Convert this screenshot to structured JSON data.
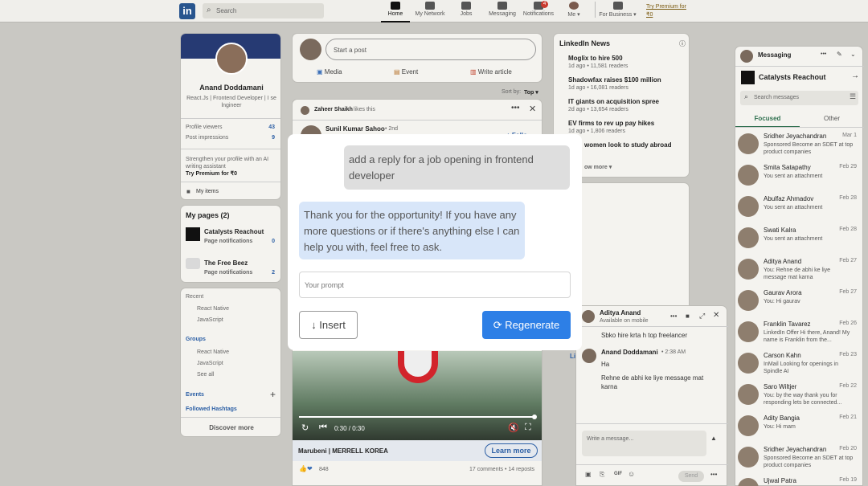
{
  "nav": {
    "logo": "in",
    "search_placeholder": "Search",
    "items": [
      "Home",
      "My Network",
      "Jobs",
      "Messaging",
      "Notifications",
      "Me ▾",
      "For Business ▾"
    ],
    "notif_count": "4",
    "premium": "Try Premium for ₹0"
  },
  "profile": {
    "name": "Anand Doddamani",
    "headline": "React.Js | Frontend Developer | I se lngineer",
    "viewers_label": "Profile viewers",
    "viewers": "43",
    "impressions_label": "Post impressions",
    "impressions": "9",
    "premium_text": "Strengthen your profile with an AI writing assistant",
    "premium_link": "Try Premium for ₹0",
    "my_items": "My items"
  },
  "pages": {
    "title": "My pages (2)",
    "items": [
      {
        "name": "Catalysts Reachout",
        "sub": "Page notifications",
        "count": "0"
      },
      {
        "name": "The Free Beez",
        "sub": "Page notifications",
        "count": "2"
      }
    ]
  },
  "recent": {
    "title": "Recent",
    "items": [
      "React Native",
      "JavaScript"
    ],
    "groups_title": "Groups",
    "groups": [
      "React Native",
      "JavaScript"
    ],
    "see_all": "See all",
    "events": "Events",
    "hashtags": "Followed Hashtags",
    "discover": "Discover more"
  },
  "post": {
    "start": "Start a post",
    "media": "Media",
    "event": "Event",
    "article": "Write article",
    "sort": "Sort by:",
    "sort_value": "Top ▾",
    "liker": "Zaheer Shaikh",
    "likes_this": "likes this",
    "author": "Sunil Kumar Sahoo",
    "degree": "• 2nd",
    "video_time": "0:30 / 0:30",
    "company": "Marubeni | MERRELL KOREA",
    "learn_more": "Learn more",
    "reactions": "848",
    "comments": "17 comments • 14 reposts",
    "partial_follow": "+ Follo"
  },
  "news": {
    "title": "LinkedIn News",
    "items": [
      {
        "h": "Moglix to hire 500",
        "s": "1d ago • 11,581 readers"
      },
      {
        "h": "Shadowfax raises $100 million",
        "s": "1d ago • 16,081 readers"
      },
      {
        "h": "IT giants on acquisition spree",
        "s": "2d ago • 13,654 readers"
      },
      {
        "h": "EV firms to rev up pay hikes",
        "s": "1d ago • 1,806 readers"
      }
    ],
    "partial": "women look to study abroad",
    "more": "ow more ▾"
  },
  "modal": {
    "user_msg": "add a reply for a job opening in frontend developer",
    "ai_msg": "Thank you for the opportunity! If you have any more questions or if there's anything else I can help you with, feel free to ask.",
    "prompt_placeholder": "Your prompt",
    "insert": "↓ Insert",
    "regenerate": "Regenerate"
  },
  "chat": {
    "name": "Aditya Anand",
    "status": "Available on mobile",
    "line1": "Sbko hire krta h top freelancer",
    "sender": "Anand Doddamani",
    "time": "• 2:38 AM",
    "m1": "Ha",
    "m2": "Rehne de abhi ke liye message mat karna",
    "input": "Write a message...",
    "send": "Send",
    "gif": "GIF",
    "li_partial": "Li"
  },
  "messaging": {
    "title": "Messaging",
    "page": "Catalysts Reachout",
    "search": "Search messages",
    "tab_focused": "Focused",
    "tab_other": "Other",
    "conversations": [
      {
        "name": "Sridher Jeyachandran",
        "date": "Mar 1",
        "preview": "Sponsored  Become an SDET at top product companies"
      },
      {
        "name": "Smita Satapathy",
        "date": "Feb 29",
        "preview": "You sent an attachment"
      },
      {
        "name": "Abulfaz Ahmadov",
        "date": "Feb 28",
        "preview": "You sent an attachment"
      },
      {
        "name": "Swati Kalra",
        "date": "Feb 28",
        "preview": "You sent an attachment"
      },
      {
        "name": "Aditya Anand",
        "date": "Feb 27",
        "preview": "You: Rehne de abhi ke liye message mat karna"
      },
      {
        "name": "Gaurav Arora",
        "date": "Feb 27",
        "preview": "You: Hi gaurav"
      },
      {
        "name": "Franklin Tavarez",
        "date": "Feb 26",
        "preview": "LinkedIn Offer  Hi there, Anand! My name is Franklin from the..."
      },
      {
        "name": "Carson Kahn",
        "date": "Feb 23",
        "preview": "InMail  Looking for openings in Spindle AI"
      },
      {
        "name": "Saro Wiltjer",
        "date": "Feb 22",
        "preview": "You: by the way thank you for responding lets be connected..."
      },
      {
        "name": "Adity Bangia",
        "date": "Feb 21",
        "preview": "You: Hi mam"
      },
      {
        "name": "Sridher Jeyachandran",
        "date": "Feb 20",
        "preview": "Sponsored  Become an SDET at top product companies"
      },
      {
        "name": "Ujwal Patra",
        "date": "Feb 19",
        "preview": ""
      }
    ]
  }
}
